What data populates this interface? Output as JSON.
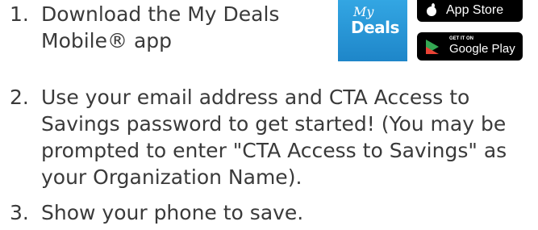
{
  "steps": [
    {
      "number": "1.",
      "text": "Download the My Deals Mobile® app"
    },
    {
      "number": "2.",
      "text": "Use your email address and CTA Access to Savings password to get started! (You may be prompted to enter \"CTA Access to Savings\" as your Organization Name)."
    },
    {
      "number": "3.",
      "text": "Show your phone to save."
    }
  ],
  "app_icon": {
    "line1": "My",
    "line2": "Deals",
    "color": "#2a97d8"
  },
  "app_store": {
    "label": "App Store",
    "icon": "apple-icon"
  },
  "google_play": {
    "small": "GET IT ON",
    "label": "Google Play",
    "icon": "google-play-icon"
  }
}
